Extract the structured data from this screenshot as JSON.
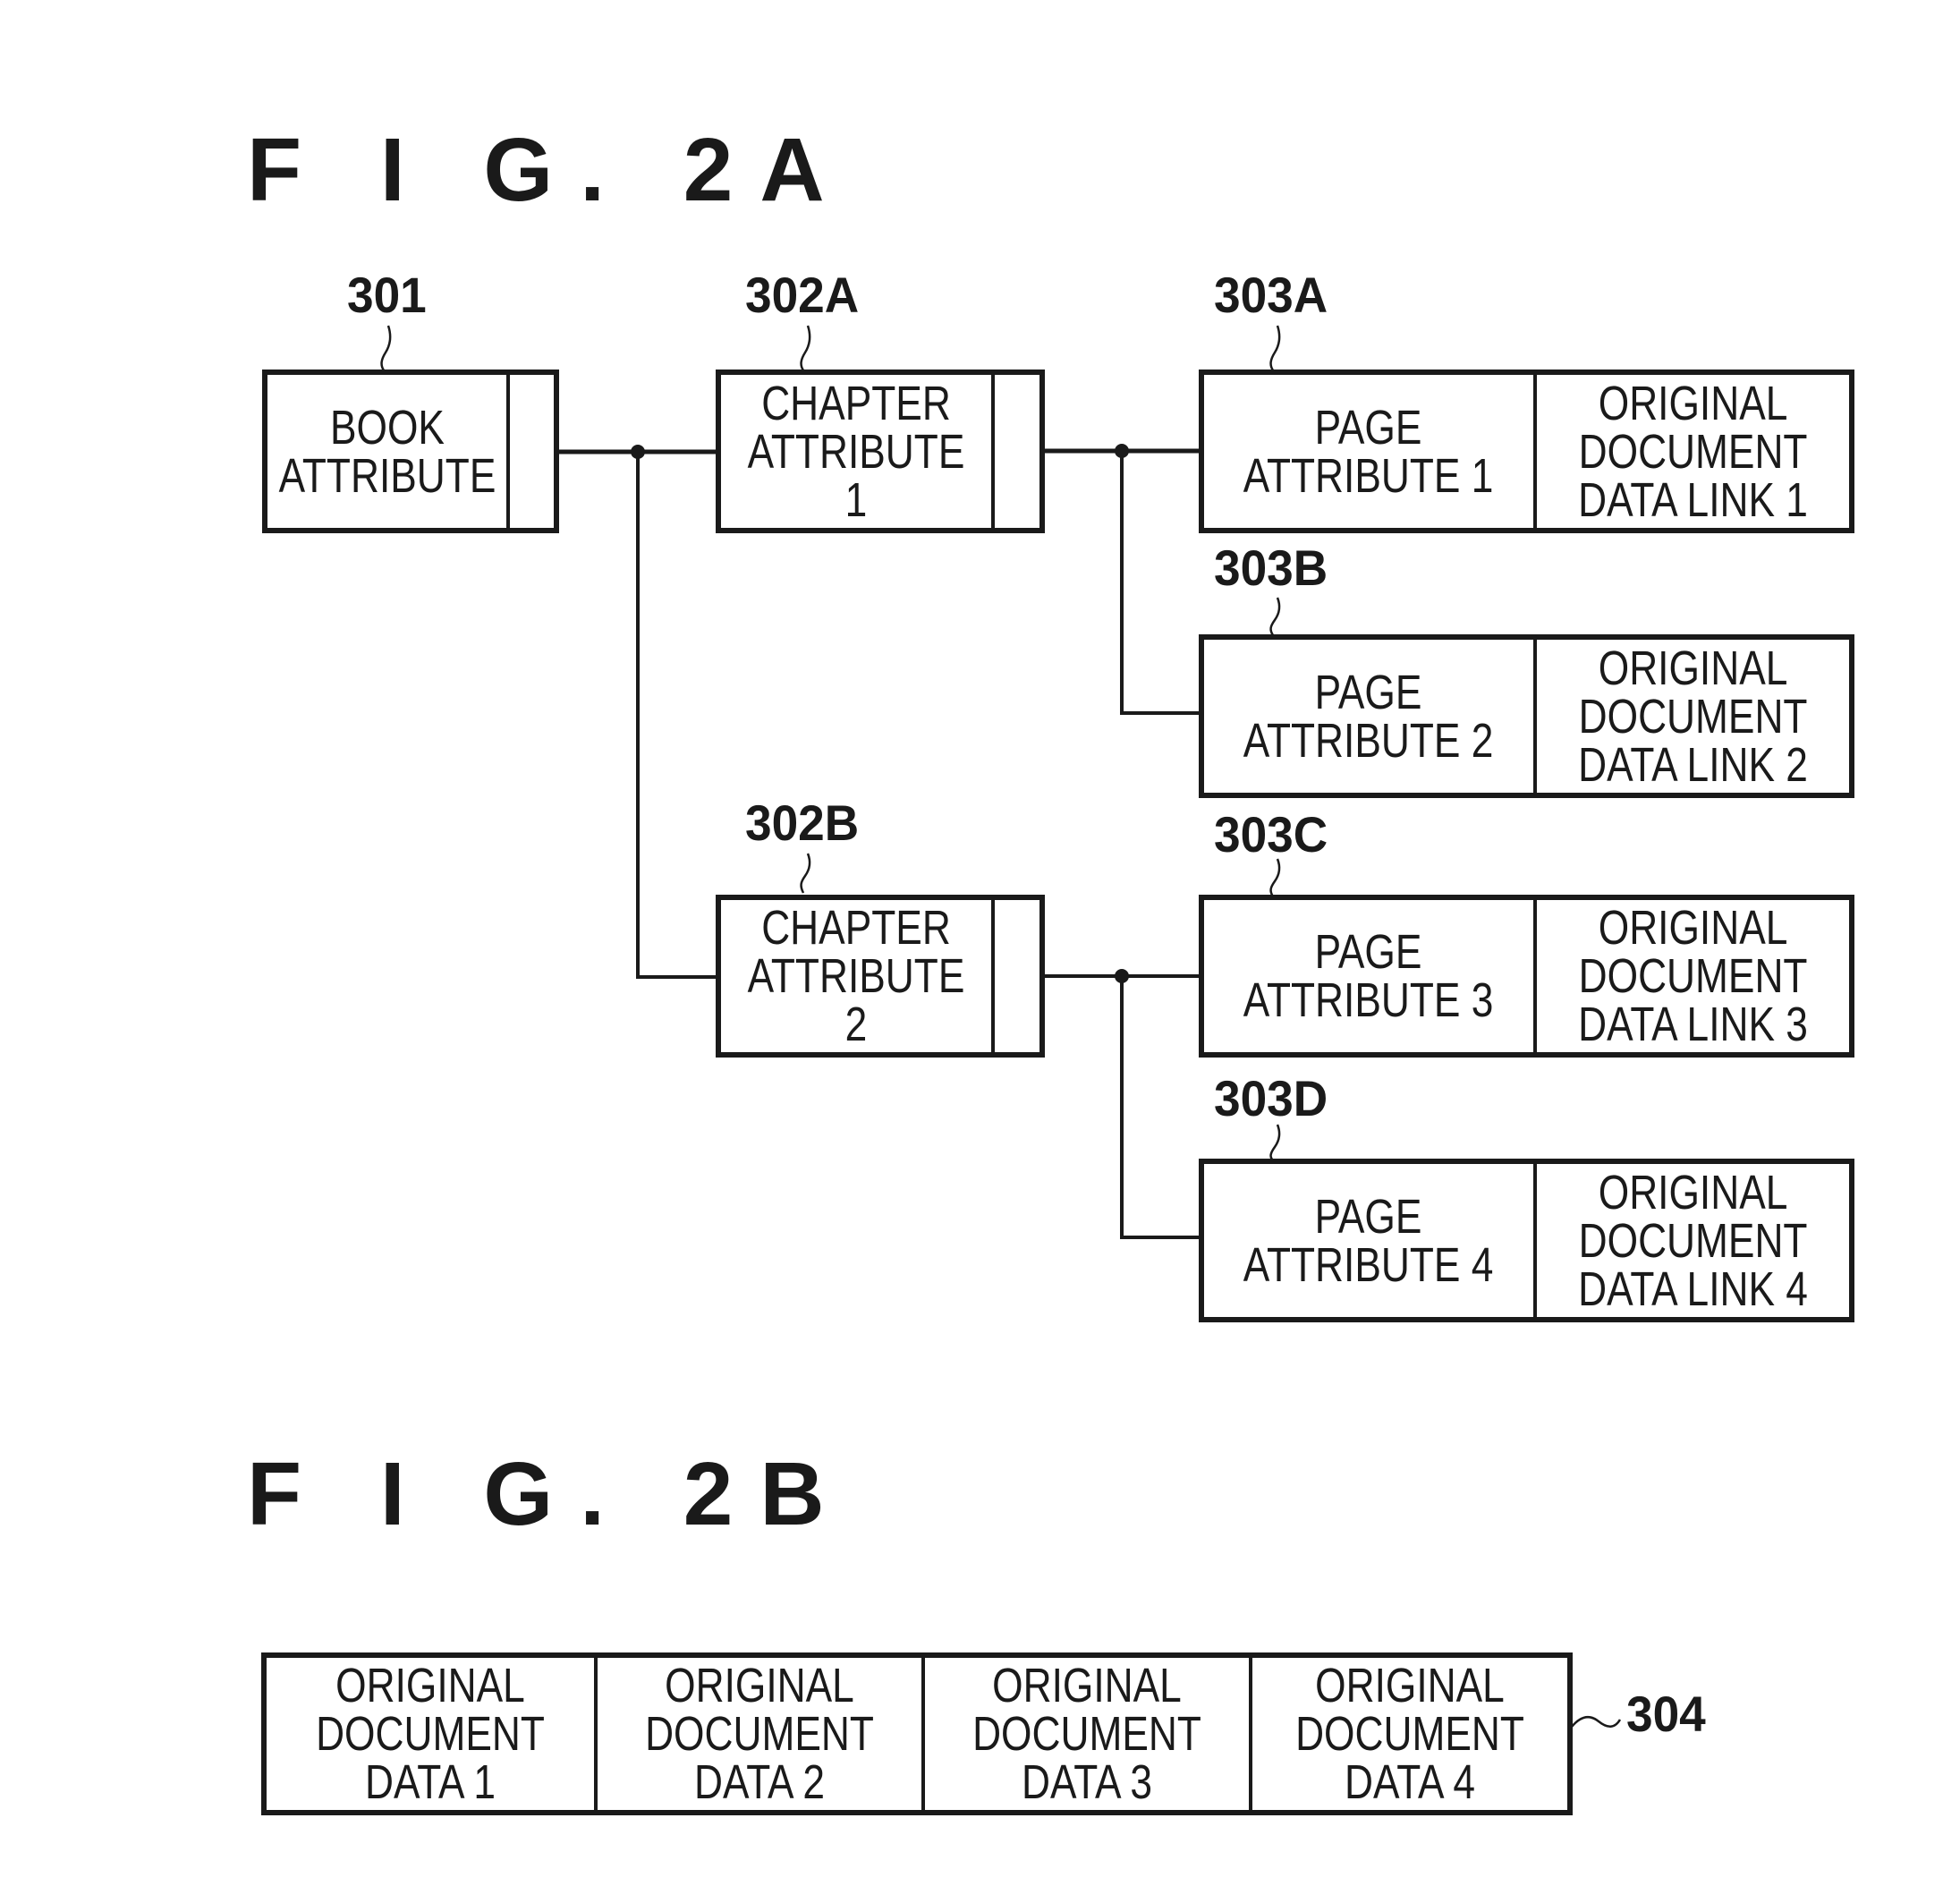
{
  "figure_2a": {
    "title": "F I G.  2A",
    "book": {
      "ref": "301",
      "label": "BOOK\nATTRIBUTE"
    },
    "chapters": [
      {
        "ref": "302A",
        "label": "CHAPTER\nATTRIBUTE 1"
      },
      {
        "ref": "302B",
        "label": "CHAPTER\nATTRIBUTE 2"
      }
    ],
    "pages": [
      {
        "ref": "303A",
        "label": "PAGE\nATTRIBUTE 1",
        "link": "ORIGINAL\nDOCUMENT\nDATA LINK 1"
      },
      {
        "ref": "303B",
        "label": "PAGE\nATTRIBUTE 2",
        "link": "ORIGINAL\nDOCUMENT\nDATA LINK 2"
      },
      {
        "ref": "303C",
        "label": "PAGE\nATTRIBUTE 3",
        "link": "ORIGINAL\nDOCUMENT\nDATA LINK 3"
      },
      {
        "ref": "303D",
        "label": "PAGE\nATTRIBUTE 4",
        "link": "ORIGINAL\nDOCUMENT\nDATA LINK 4"
      }
    ]
  },
  "figure_2b": {
    "title": "F I G.  2B",
    "ref": "304",
    "cells": [
      "ORIGINAL\nDOCUMENT\nDATA 1",
      "ORIGINAL\nDOCUMENT\nDATA 2",
      "ORIGINAL\nDOCUMENT\nDATA 3",
      "ORIGINAL\nDOCUMENT\nDATA 4"
    ]
  }
}
